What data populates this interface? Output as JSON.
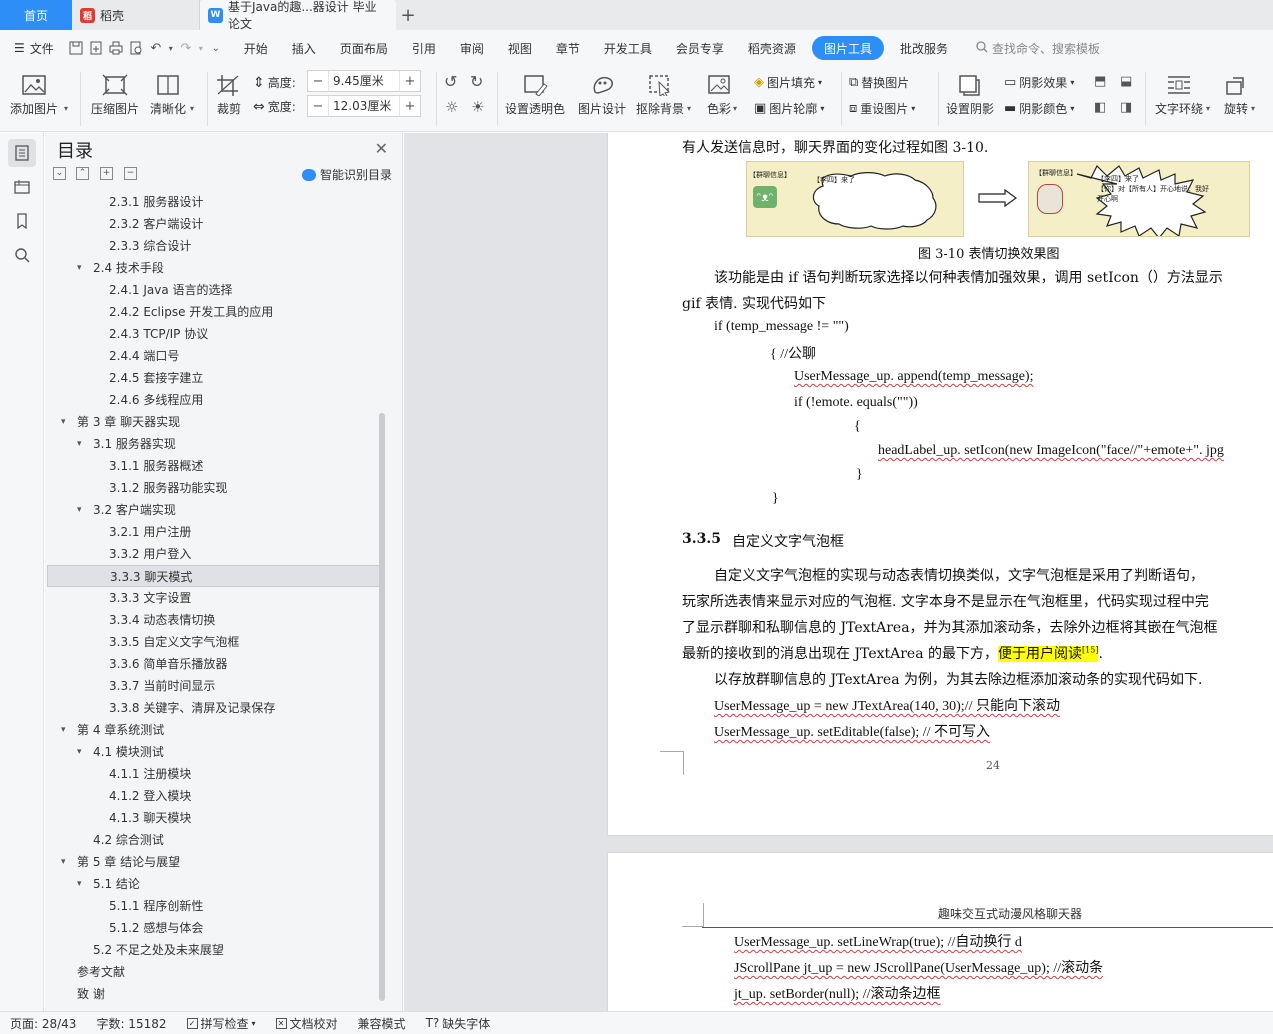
{
  "tabs": {
    "home": "首页",
    "doke": "稻壳",
    "document": "基于Java的趣...器设计 毕业论文"
  },
  "menu": {
    "file": "文件",
    "items": [
      "开始",
      "插入",
      "页面布局",
      "引用",
      "审阅",
      "视图",
      "章节",
      "开发工具",
      "会员专享",
      "稻壳资源"
    ],
    "active": "图片工具",
    "after_active": "批改服务",
    "search_placeholder": "查找命令、搜索模板"
  },
  "ribbon": {
    "add_picture": "添加图片",
    "compress_picture": "压缩图片",
    "sharpen": "清晰化",
    "crop": "裁剪",
    "height_label": "高度:",
    "height_value": "9.45厘米",
    "width_label": "宽度:",
    "width_value": "12.03厘米",
    "set_transparent": "设置透明色",
    "picture_design": "图片设计",
    "remove_background": "抠除背景",
    "color": "色彩",
    "picture_fill": "图片填充",
    "picture_outline": "图片轮廓",
    "replace_picture": "替换图片",
    "reset_picture": "重设图片",
    "set_shadow": "设置阴影",
    "shadow_effect": "阴影效果",
    "shadow_color": "阴影颜色",
    "text_wrap": "文字环绕",
    "rotate": "旋转"
  },
  "toc": {
    "title": "目录",
    "smart_label": "智能识别目录",
    "items": [
      {
        "text": "2.3.1  服务器设计",
        "level": 3
      },
      {
        "text": "2.3.2  客户端设计",
        "level": 3
      },
      {
        "text": "2.3.3  综合设计",
        "level": 3
      },
      {
        "text": "2.4  技术手段",
        "level": 2,
        "caret": true
      },
      {
        "text": "2.4.1 Java 语言的选择",
        "level": 3
      },
      {
        "text": "2.4.2 Eclipse 开发工具的应用",
        "level": 3
      },
      {
        "text": "2.4.3 TCP/IP 协议",
        "level": 3
      },
      {
        "text": "2.4.4  端口号",
        "level": 3
      },
      {
        "text": "2.4.5  套接字建立",
        "level": 3
      },
      {
        "text": "2.4.6  多线程应用",
        "level": 3
      },
      {
        "text": "第 3 章  聊天器实现",
        "level": 1,
        "caret": true
      },
      {
        "text": "3.1  服务器实现",
        "level": 2,
        "caret": true
      },
      {
        "text": "3.1.1  服务器概述",
        "level": 3
      },
      {
        "text": "3.1.2  服务器功能实现",
        "level": 3
      },
      {
        "text": "3.2  客户端实现",
        "level": 2,
        "caret": true
      },
      {
        "text": "3.2.1  用户注册",
        "level": 3
      },
      {
        "text": "3.3.2  用户登入",
        "level": 3
      },
      {
        "text": "3.3.3  聊天模式",
        "level": 3,
        "selected": true
      },
      {
        "text": "3.3.3  文字设置",
        "level": 3
      },
      {
        "text": "3.3.4  动态表情切换",
        "level": 3
      },
      {
        "text": "3.3.5  自定义文字气泡框",
        "level": 3
      },
      {
        "text": "3.3.6  简单音乐播放器",
        "level": 3
      },
      {
        "text": "3.3.7  当前时间显示",
        "level": 3
      },
      {
        "text": "3.3.8  关键字、清屏及记录保存",
        "level": 3
      },
      {
        "text": "第 4 章系统测试",
        "level": 1,
        "caret": true
      },
      {
        "text": "4.1  模块测试",
        "level": 2,
        "caret": true
      },
      {
        "text": "4.1.1  注册模块",
        "level": 3
      },
      {
        "text": "4.1.2  登入模块",
        "level": 3
      },
      {
        "text": "4.1.3  聊天模块",
        "level": 3
      },
      {
        "text": "4.2  综合测试",
        "level": 2
      },
      {
        "text": "第 5 章  结论与展望",
        "level": 1,
        "caret": true
      },
      {
        "text": "5.1  结论",
        "level": 2,
        "caret": true
      },
      {
        "text": "5.1.1  程序创新性",
        "level": 3
      },
      {
        "text": "5.1.2  感想与体会",
        "level": 3
      },
      {
        "text": "5.2  不足之处及未来展望",
        "level": 2
      },
      {
        "text": "参考文献",
        "level": 1
      },
      {
        "text": "致    谢",
        "level": 1
      }
    ]
  },
  "page1": {
    "intro_line": "有人发送信息时，聊天界面的变化过程如图 3-10.",
    "figure": {
      "left_label": "【群聊信息】",
      "left_bubble": "【李四】来了",
      "right_label": "【群聊信息】",
      "right_bubble_1": "【李四】来了",
      "right_bubble_2": "【你】对【所有人】开心地说：我好开心啊",
      "caption": "图 3-10  表情切换效果图"
    },
    "para1_line1": "该功能是由 if 语句判断玩家选择以何种表情加强效果，调用 setIcon（）方法显示",
    "para1_line2": "gif 表情. 实现代码如下",
    "code": [
      "if (temp_message != \"\")",
      "{     //公聊",
      "UserMessage_up. append(temp_message);",
      "if (!emote. equals(\"\"))",
      "{",
      "headLabel_up. setIcon(new ImageIcon(\"face//\"+emote+\". jpg",
      "}",
      "}"
    ],
    "heading_num": "3.3.5",
    "heading_text": "自定义文字气泡框",
    "para2": [
      "自定义文字气泡框的实现与动态表情切换类似，文字气泡框是采用了判断语句，",
      "玩家所选表情来显示对应的气泡框. 文字本身不是显示在气泡框里，代码实现过程中完",
      "了显示群聊和私聊信息的 JTextArea，并为其添加滚动条，去除外边框将其嵌在气泡框",
      "最新的接收到的消息出现在 JTextArea 的最下方，"
    ],
    "para2_highlight": "便于用户阅读",
    "para2_cite": "[15]",
    "para2_end": ".",
    "para3": "以存放群聊信息的 JTextArea 为例，为其去除边框添加滚动条的实现代码如下.",
    "code2_1": "UserMessage_up = new JTextArea(140, 30);//  只能向下滚动",
    "code2_2": "UserMessage_up. setEditable(false); //  不可写入",
    "page_number": "24"
  },
  "page2": {
    "header": "趣味交互式动漫风格聊天器",
    "line1": "UserMessage_up. setLineWrap(true);  //自动换行 d",
    "line2": "JScrollPane jt_up = new JScrollPane(UserMessage_up);       //滚动条",
    "line3": "jt_up. setBorder(null);      //滚动条边框"
  },
  "status": {
    "page": "页面: 28/43",
    "words": "字数: 15182",
    "spell": "拼写检查",
    "doc_check": "文档校对",
    "compat": "兼容模式",
    "missing_font": "缺失字体"
  },
  "colors": {
    "accent": "#2e8ef8",
    "highlight": "#ffff00",
    "figure_bg": "#f4efc6"
  }
}
